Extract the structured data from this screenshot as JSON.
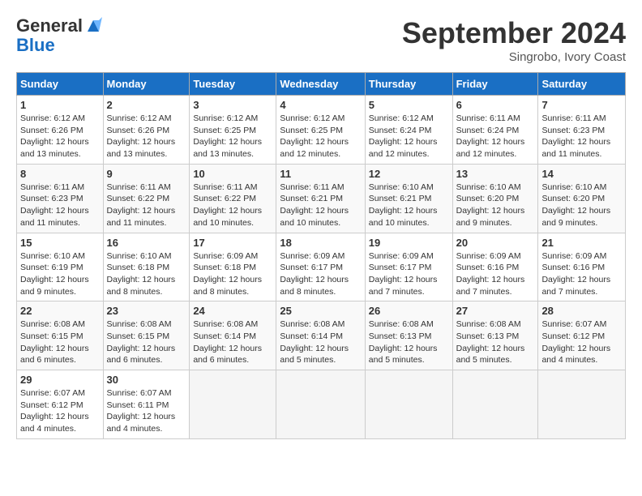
{
  "header": {
    "logo_line1": "General",
    "logo_line2": "Blue",
    "month_title": "September 2024",
    "location": "Singrobo, Ivory Coast"
  },
  "days_of_week": [
    "Sunday",
    "Monday",
    "Tuesday",
    "Wednesday",
    "Thursday",
    "Friday",
    "Saturday"
  ],
  "weeks": [
    [
      {
        "day": "1",
        "sunrise": "6:12 AM",
        "sunset": "6:26 PM",
        "daylight": "12 hours and 13 minutes."
      },
      {
        "day": "2",
        "sunrise": "6:12 AM",
        "sunset": "6:26 PM",
        "daylight": "12 hours and 13 minutes."
      },
      {
        "day": "3",
        "sunrise": "6:12 AM",
        "sunset": "6:25 PM",
        "daylight": "12 hours and 13 minutes."
      },
      {
        "day": "4",
        "sunrise": "6:12 AM",
        "sunset": "6:25 PM",
        "daylight": "12 hours and 12 minutes."
      },
      {
        "day": "5",
        "sunrise": "6:12 AM",
        "sunset": "6:24 PM",
        "daylight": "12 hours and 12 minutes."
      },
      {
        "day": "6",
        "sunrise": "6:11 AM",
        "sunset": "6:24 PM",
        "daylight": "12 hours and 12 minutes."
      },
      {
        "day": "7",
        "sunrise": "6:11 AM",
        "sunset": "6:23 PM",
        "daylight": "12 hours and 11 minutes."
      }
    ],
    [
      {
        "day": "8",
        "sunrise": "6:11 AM",
        "sunset": "6:23 PM",
        "daylight": "12 hours and 11 minutes."
      },
      {
        "day": "9",
        "sunrise": "6:11 AM",
        "sunset": "6:22 PM",
        "daylight": "12 hours and 11 minutes."
      },
      {
        "day": "10",
        "sunrise": "6:11 AM",
        "sunset": "6:22 PM",
        "daylight": "12 hours and 10 minutes."
      },
      {
        "day": "11",
        "sunrise": "6:11 AM",
        "sunset": "6:21 PM",
        "daylight": "12 hours and 10 minutes."
      },
      {
        "day": "12",
        "sunrise": "6:10 AM",
        "sunset": "6:21 PM",
        "daylight": "12 hours and 10 minutes."
      },
      {
        "day": "13",
        "sunrise": "6:10 AM",
        "sunset": "6:20 PM",
        "daylight": "12 hours and 9 minutes."
      },
      {
        "day": "14",
        "sunrise": "6:10 AM",
        "sunset": "6:20 PM",
        "daylight": "12 hours and 9 minutes."
      }
    ],
    [
      {
        "day": "15",
        "sunrise": "6:10 AM",
        "sunset": "6:19 PM",
        "daylight": "12 hours and 9 minutes."
      },
      {
        "day": "16",
        "sunrise": "6:10 AM",
        "sunset": "6:18 PM",
        "daylight": "12 hours and 8 minutes."
      },
      {
        "day": "17",
        "sunrise": "6:09 AM",
        "sunset": "6:18 PM",
        "daylight": "12 hours and 8 minutes."
      },
      {
        "day": "18",
        "sunrise": "6:09 AM",
        "sunset": "6:17 PM",
        "daylight": "12 hours and 8 minutes."
      },
      {
        "day": "19",
        "sunrise": "6:09 AM",
        "sunset": "6:17 PM",
        "daylight": "12 hours and 7 minutes."
      },
      {
        "day": "20",
        "sunrise": "6:09 AM",
        "sunset": "6:16 PM",
        "daylight": "12 hours and 7 minutes."
      },
      {
        "day": "21",
        "sunrise": "6:09 AM",
        "sunset": "6:16 PM",
        "daylight": "12 hours and 7 minutes."
      }
    ],
    [
      {
        "day": "22",
        "sunrise": "6:08 AM",
        "sunset": "6:15 PM",
        "daylight": "12 hours and 6 minutes."
      },
      {
        "day": "23",
        "sunrise": "6:08 AM",
        "sunset": "6:15 PM",
        "daylight": "12 hours and 6 minutes."
      },
      {
        "day": "24",
        "sunrise": "6:08 AM",
        "sunset": "6:14 PM",
        "daylight": "12 hours and 6 minutes."
      },
      {
        "day": "25",
        "sunrise": "6:08 AM",
        "sunset": "6:14 PM",
        "daylight": "12 hours and 5 minutes."
      },
      {
        "day": "26",
        "sunrise": "6:08 AM",
        "sunset": "6:13 PM",
        "daylight": "12 hours and 5 minutes."
      },
      {
        "day": "27",
        "sunrise": "6:08 AM",
        "sunset": "6:13 PM",
        "daylight": "12 hours and 5 minutes."
      },
      {
        "day": "28",
        "sunrise": "6:07 AM",
        "sunset": "6:12 PM",
        "daylight": "12 hours and 4 minutes."
      }
    ],
    [
      {
        "day": "29",
        "sunrise": "6:07 AM",
        "sunset": "6:12 PM",
        "daylight": "12 hours and 4 minutes."
      },
      {
        "day": "30",
        "sunrise": "6:07 AM",
        "sunset": "6:11 PM",
        "daylight": "12 hours and 4 minutes."
      },
      null,
      null,
      null,
      null,
      null
    ]
  ]
}
